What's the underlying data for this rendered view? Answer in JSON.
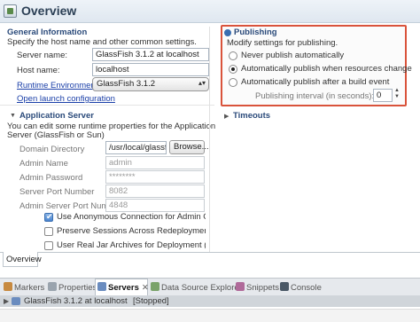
{
  "header": {
    "title": "Overview"
  },
  "general": {
    "title": "General Information",
    "desc": "Specify the host name and other common settings.",
    "server_name_label": "Server name:",
    "server_name_value": "GlassFish 3.1.2 at localhost",
    "host_name_label": "Host name:",
    "host_name_value": "localhost",
    "runtime_label": "Runtime Environment:",
    "runtime_value": "GlassFish 3.1.2",
    "open_launch": "Open launch configuration"
  },
  "app_server": {
    "title": "Application Server",
    "desc_line1": "You can edit some runtime properties for the Application",
    "desc_line2": "Server (GlassFish or Sun)",
    "domain_dir_label": "Domain Directory",
    "domain_dir_value": "/usr/local/glassfish",
    "browse": "Browse...",
    "admin_name_label": "Admin Name",
    "admin_name_value": "admin",
    "admin_password_label": "Admin Password",
    "admin_password_value": "********",
    "server_port_label": "Server Port Number",
    "server_port_value": "8082",
    "admin_port_label": "Admin Server Port Number",
    "admin_port_value": "4848",
    "checks": [
      {
        "label": "Use Anonymous Connection for Admin Comman",
        "checked": true
      },
      {
        "label": "Preserve Sessions Across Redeployment",
        "checked": false
      },
      {
        "label": "User Real Jar Archives for Deployment (slower th",
        "checked": false
      }
    ]
  },
  "publishing": {
    "title": "Publishing",
    "desc": "Modify settings for publishing.",
    "options": [
      {
        "label": "Never publish automatically",
        "selected": false
      },
      {
        "label": "Automatically publish when resources change",
        "selected": true
      },
      {
        "label": "Automatically publish after a build event",
        "selected": false
      }
    ],
    "interval_label": "Publishing interval (in seconds):",
    "interval_value": "0"
  },
  "timeouts": {
    "title": "Timeouts"
  },
  "editor_tab": "Overview",
  "views": [
    {
      "label": "Markers",
      "active": false
    },
    {
      "label": "Properties",
      "active": false
    },
    {
      "label": "Servers",
      "active": true
    },
    {
      "label": "Data Source Explorer",
      "active": false
    },
    {
      "label": "Snippets",
      "active": false
    },
    {
      "label": "Console",
      "active": false
    }
  ],
  "server_row": {
    "name": "GlassFish 3.1.2 at localhost",
    "status": "[Stopped]"
  }
}
